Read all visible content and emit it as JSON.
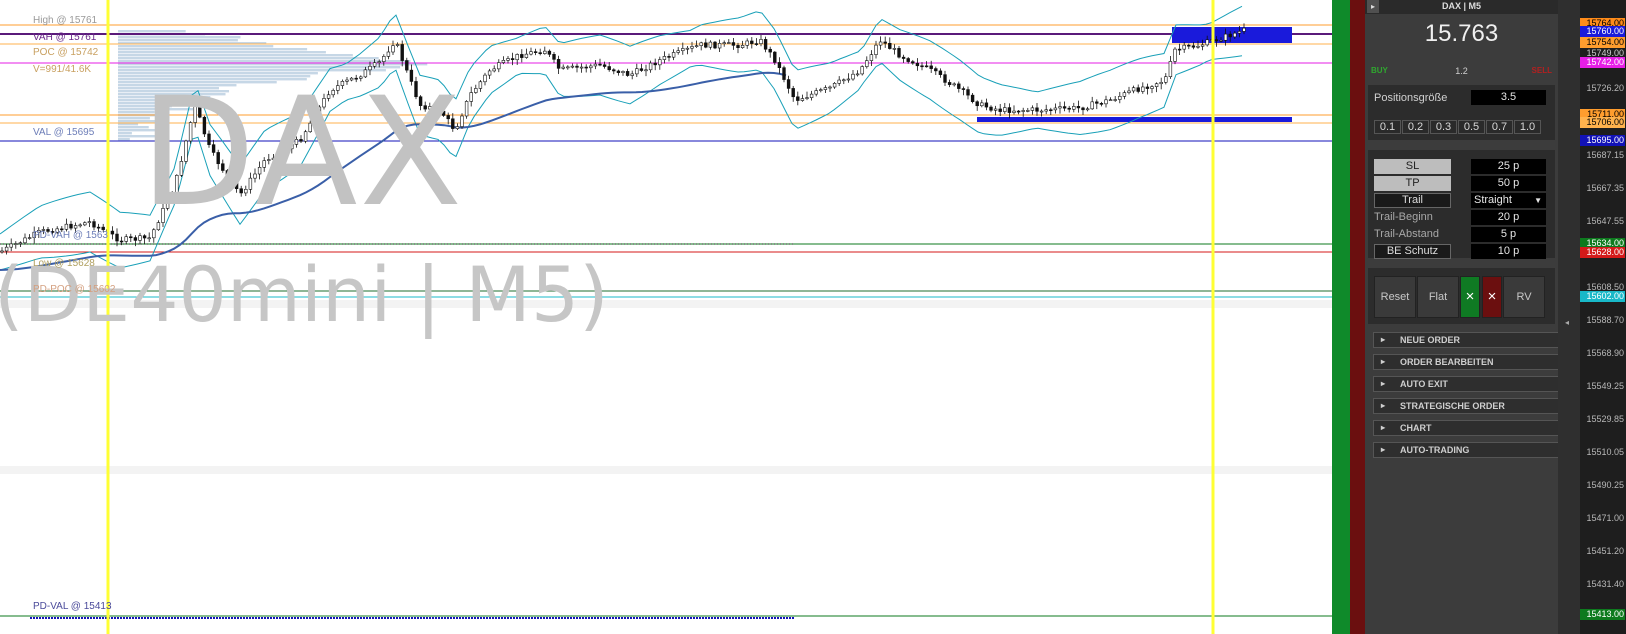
{
  "chart": {
    "watermark_symbol": "DAX",
    "watermark_instrument": "(DE40mini | M5)",
    "levels": {
      "high": "High @ 15761",
      "vah": "VAH @ 15761",
      "poc": "POC @ 15742",
      "volume": "V=991/41.6K",
      "val": "VAL @ 15695",
      "pd_vah": "PD-VAH @ 1563",
      "pd_low": "Low @ 15628",
      "pd_poc": "PD-POC @ 15602",
      "pd_val": "PD-VAL @ 15413"
    }
  },
  "panel": {
    "header": "DAX | M5",
    "price_display": "15.763",
    "buy_label": "BUY",
    "spread": "1.2",
    "sell_label": "SELL",
    "position_label": "Positionsgröße",
    "position_value": "3.5",
    "steps": [
      "0.1",
      "0.2",
      "0.3",
      "0.5",
      "0.7",
      "1.0"
    ],
    "sl_label": "SL",
    "sl_value": "25 p",
    "tp_label": "TP",
    "tp_value": "50 p",
    "trail_label": "Trail",
    "trail_mode": "Straight",
    "trail_begin_label": "Trail-Beginn",
    "trail_begin_value": "20 p",
    "trail_dist_label": "Trail-Abstand",
    "trail_dist_value": "5 p",
    "be_label": "BE Schutz",
    "be_value": "10 p",
    "reset_label": "Reset",
    "flat_label": "Flat",
    "close_buy_label": "×",
    "close_sell_label": "×",
    "rv_label": "RV",
    "sections": [
      "NEUE ORDER",
      "ORDER BEARBEITEN",
      "AUTO EXIT",
      "STRATEGISCHE ORDER",
      "CHART",
      "AUTO-TRADING"
    ]
  },
  "axis": {
    "ticks": [
      "15726.20",
      "15687.15",
      "15667.35",
      "15647.55",
      "15608.50",
      "15588.70",
      "15568.90",
      "15549.25",
      "15529.85",
      "15510.05",
      "15490.25",
      "15471.00",
      "15451.20",
      "15431.40",
      "15413.00"
    ],
    "tags": [
      {
        "value": "15764.00",
        "bg": "#ff8c1a",
        "fg": "#000000"
      },
      {
        "value": "15760.00",
        "bg": "#1a1adb",
        "fg": "#ffffff"
      },
      {
        "value": "15754.00",
        "bg": "#ff9d2e",
        "fg": "#000000"
      },
      {
        "value": "15749.00",
        "bg": "#1e1e1e",
        "fg": "#cccccc"
      },
      {
        "value": "15742.00",
        "bg": "#e61ee6",
        "fg": "#ffffff"
      },
      {
        "value": "15711.00",
        "bg": "#ff9d2e",
        "fg": "#000000"
      },
      {
        "value": "15706.00",
        "bg": "#ffb24d",
        "fg": "#000000"
      },
      {
        "value": "15695.00",
        "bg": "#1212b8",
        "fg": "#ffffff"
      },
      {
        "value": "15634.00",
        "bg": "#0d7a1e",
        "fg": "#ffffff"
      },
      {
        "value": "15628.00",
        "bg": "#d41a1a",
        "fg": "#ffffff"
      },
      {
        "value": "15602.00",
        "bg": "#19b8c8",
        "fg": "#ffffff"
      },
      {
        "value": "15413.00",
        "bg": "#0d7a1e",
        "fg": "#ffffff"
      }
    ]
  },
  "colors": {
    "session_line": "#ffff33",
    "high_line": "#ff9d2e",
    "vah_line": "#5a1a7a",
    "poc_line": "#e61ee6",
    "val_line": "#1212b8",
    "bollinger": "#19a0b8",
    "ma": "#3a5fa8",
    "volume_profile": "#b8cde0"
  }
}
